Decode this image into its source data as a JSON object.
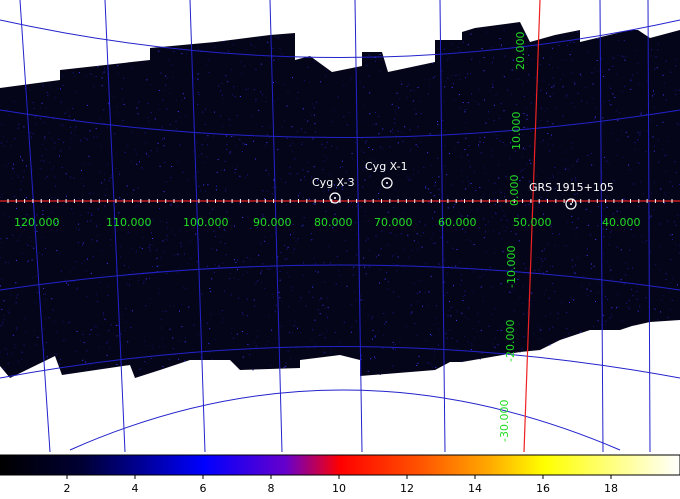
{
  "colors": {
    "background": "#ffffff",
    "sky": "#05051a",
    "grid": "#2222cc",
    "axis": "#ee2222",
    "axis_label": "#22dd22",
    "source_label": "#ffffff"
  },
  "x_axis_labels": [
    "120.000",
    "110.000",
    "100.000",
    "90.000",
    "80.000",
    "70.000",
    "60.000",
    "50.000",
    "40.000"
  ],
  "y_axis_labels": [
    "20.000",
    "10.000",
    "0.000",
    "-10.000",
    "-20.000",
    "-30.000"
  ],
  "sources": [
    {
      "name": "Cyg X-3"
    },
    {
      "name": "Cyg X-1"
    },
    {
      "name": "GRS 1915+105"
    }
  ],
  "colorbar": {
    "ticks": [
      "2",
      "4",
      "6",
      "8",
      "10",
      "12",
      "14",
      "16",
      "18"
    ]
  }
}
